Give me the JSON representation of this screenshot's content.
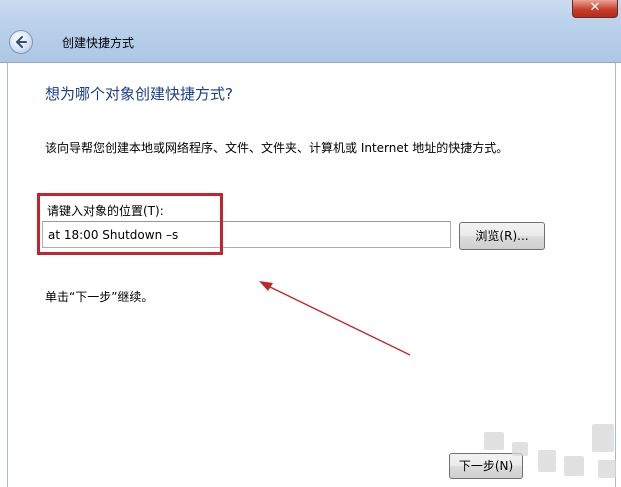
{
  "window": {
    "title": "创建快捷方式",
    "close_glyph": "✕",
    "back_icon": "back-arrow-icon"
  },
  "wizard": {
    "heading": "想为哪个对象创建快捷方式?",
    "description": "该向导帮您创建本地或网络程序、文件、文件夹、计算机或 Internet 地址的快捷方式。",
    "location_label": "请键入对象的位置(T):",
    "location_value": "at 18:00 Shutdown –s",
    "browse_label": "浏览(R)...",
    "hint": "单击“下一步”继续。",
    "next_label": "下一步(N)"
  },
  "annotations": {
    "highlight_color": "#c0262b",
    "arrow_color": "#c0262b"
  }
}
